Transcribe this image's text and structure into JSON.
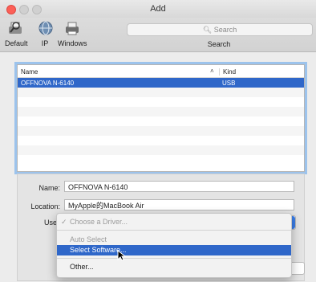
{
  "window": {
    "title": "Add"
  },
  "toolbar": {
    "default_label": "Default",
    "ip_label": "IP",
    "windows_label": "Windows",
    "search_placeholder": "Search",
    "search_label": "Search"
  },
  "list": {
    "columns": {
      "name": "Name",
      "kind": "Kind"
    },
    "rows": [
      {
        "name": "OFFNOVA N-6140",
        "kind": "USB",
        "selected": true
      }
    ]
  },
  "details": {
    "name_label": "Name:",
    "name_value": "OFFNOVA N-6140",
    "location_label": "Location:",
    "location_value": "MyApple的MacBook Air",
    "use_label": "Use"
  },
  "use_menu": {
    "items": [
      {
        "label": "Choose a Driver...",
        "state": "checked-disabled"
      },
      {
        "label": "Auto Select",
        "state": "disabled"
      },
      {
        "label": "Select Software...",
        "state": "highlighted"
      },
      {
        "label": "Other...",
        "state": "normal"
      }
    ]
  },
  "colors": {
    "selection": "#2f67c9",
    "focus_ring": "#9cc3ec",
    "close": "#fc5f57"
  }
}
